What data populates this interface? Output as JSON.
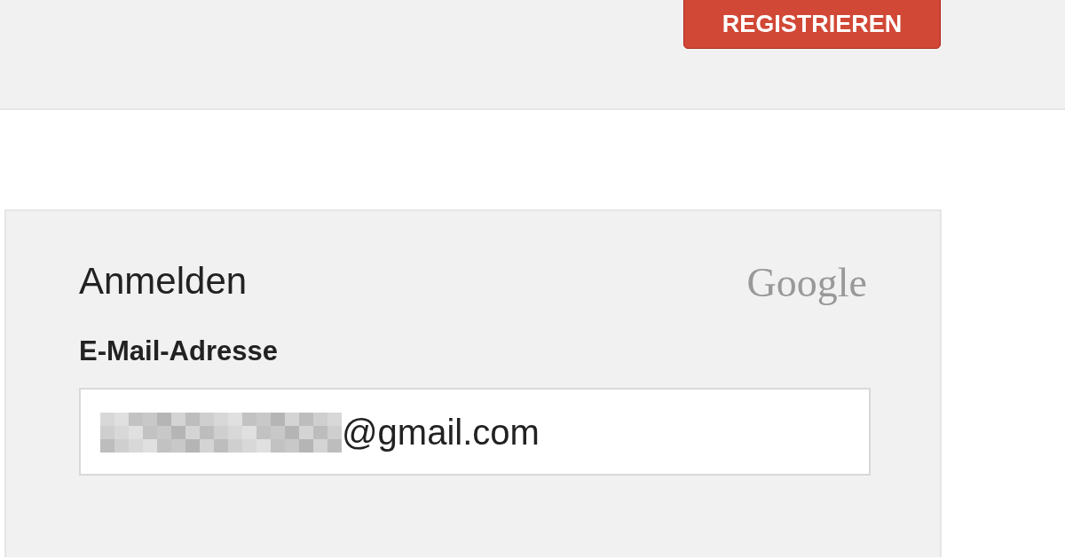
{
  "header": {
    "register_button": "REGISTRIEREN"
  },
  "signin_card": {
    "title": "Anmelden",
    "logo_text": "Google",
    "email_label": "E-Mail-Adresse",
    "email_value": "@gmail.com",
    "email_redacted": true
  }
}
